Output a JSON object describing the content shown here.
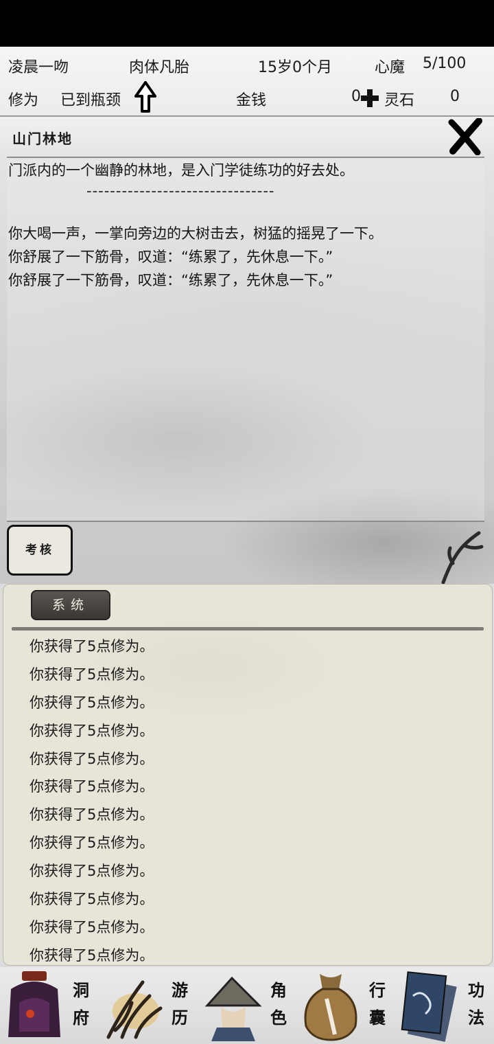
{
  "header": {
    "player_name": "凌晨一吻",
    "realm": "肉体凡胎",
    "age": "15岁0个月",
    "heart_demon_label": "心魔",
    "heart_demon_value": "5/100",
    "cultivation_label": "修为",
    "cultivation_status": "已到瓶颈",
    "money_label": "金钱",
    "money_value": "0",
    "spirit_stone_label": "灵石",
    "spirit_stone_value": "0"
  },
  "scene": {
    "title": "山门林地",
    "description": "门派内的一个幽静的林地，是入门学徒练功的好去处。",
    "divider": "--------------------------------",
    "events": [
      "你大喝一声，一掌向旁边的大树击去，树猛的摇晃了一下。",
      "你舒展了一下筋骨，叹道：“练累了，先休息一下。”",
      "你舒展了一下筋骨，叹道：“练累了，先休息一下。”"
    ],
    "exam_button": "考核"
  },
  "system": {
    "tab_label": "系统",
    "messages": [
      "你获得了5点修为。",
      "你获得了5点修为。",
      "你获得了5点修为。",
      "你获得了5点修为。",
      "你获得了5点修为。",
      "你获得了5点修为。",
      "你获得了5点修为。",
      "你获得了5点修为。",
      "你获得了5点修为。",
      "你获得了5点修为。",
      "你获得了5点修为。",
      "你获得了5点修为。"
    ]
  },
  "nav": {
    "items": [
      {
        "label": "洞府",
        "icon": "cave-mansion-icon"
      },
      {
        "label": "游历",
        "icon": "travel-grass-icon"
      },
      {
        "label": "角色",
        "icon": "character-hat-icon"
      },
      {
        "label": "行囊",
        "icon": "bag-icon"
      },
      {
        "label": "功法",
        "icon": "scroll-books-icon"
      }
    ]
  }
}
